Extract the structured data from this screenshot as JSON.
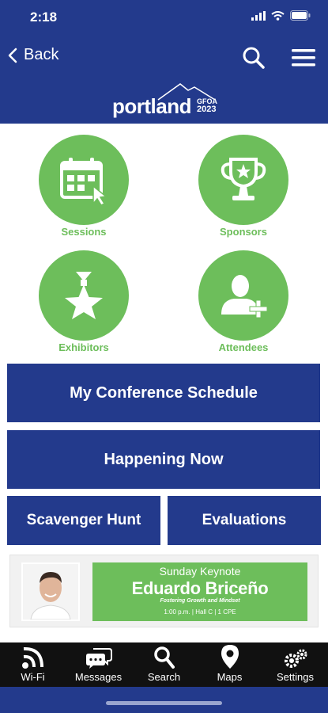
{
  "status_bar": {
    "time": "2:18"
  },
  "nav": {
    "back_label": "Back"
  },
  "logo": {
    "word": "portland",
    "tag_line1": "GFOA",
    "tag_line2": "2023"
  },
  "tiles": [
    {
      "label": "Sessions",
      "icon": "calendar-icon"
    },
    {
      "label": "Sponsors",
      "icon": "trophy-icon"
    },
    {
      "label": "Exhibitors",
      "icon": "star-ribbon-icon"
    },
    {
      "label": "Attendees",
      "icon": "person-add-icon"
    }
  ],
  "buttons": {
    "schedule": "My Conference Schedule",
    "happening": "Happening Now",
    "scavenger": "Scavenger Hunt",
    "evaluations": "Evaluations"
  },
  "banner": {
    "title": "Sunday Keynote",
    "name": "Eduardo Briceño",
    "subtitle": "Fostering Growth and Mindset",
    "detail": "1:00 p.m. | Hall C | 1 CPE"
  },
  "tabbar": [
    {
      "label": "Wi-Fi",
      "icon": "wifi-icon"
    },
    {
      "label": "Messages",
      "icon": "messages-icon"
    },
    {
      "label": "Search",
      "icon": "search-icon"
    },
    {
      "label": "Maps",
      "icon": "map-pin-icon"
    },
    {
      "label": "Settings",
      "icon": "gear-icon"
    }
  ],
  "colors": {
    "brand_blue": "#233a8c",
    "accent_green": "#6dbe5b",
    "tabbar": "#111111"
  }
}
